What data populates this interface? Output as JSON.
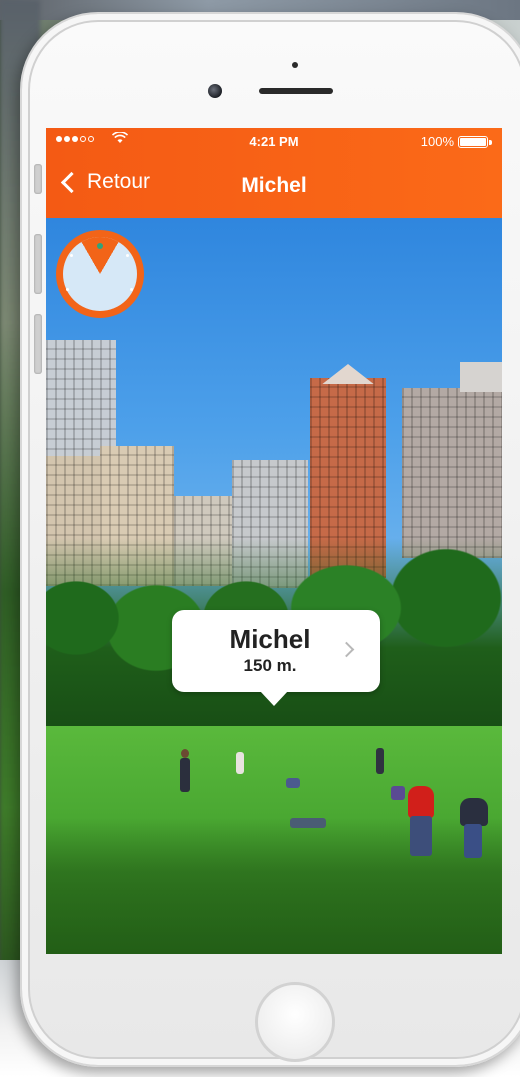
{
  "status_bar": {
    "wifi_icon": "wifi-icon",
    "time": "4:21 PM",
    "battery": "100%"
  },
  "nav_bar": {
    "back_label": "Retour",
    "title": "Michel",
    "accent_color": "#f45a14"
  },
  "ar_view": {
    "radar_icon": "radar-compass-icon",
    "callout": {
      "name": "Michel",
      "distance": "150 m.",
      "chevron_icon": "chevron-right-icon"
    }
  }
}
